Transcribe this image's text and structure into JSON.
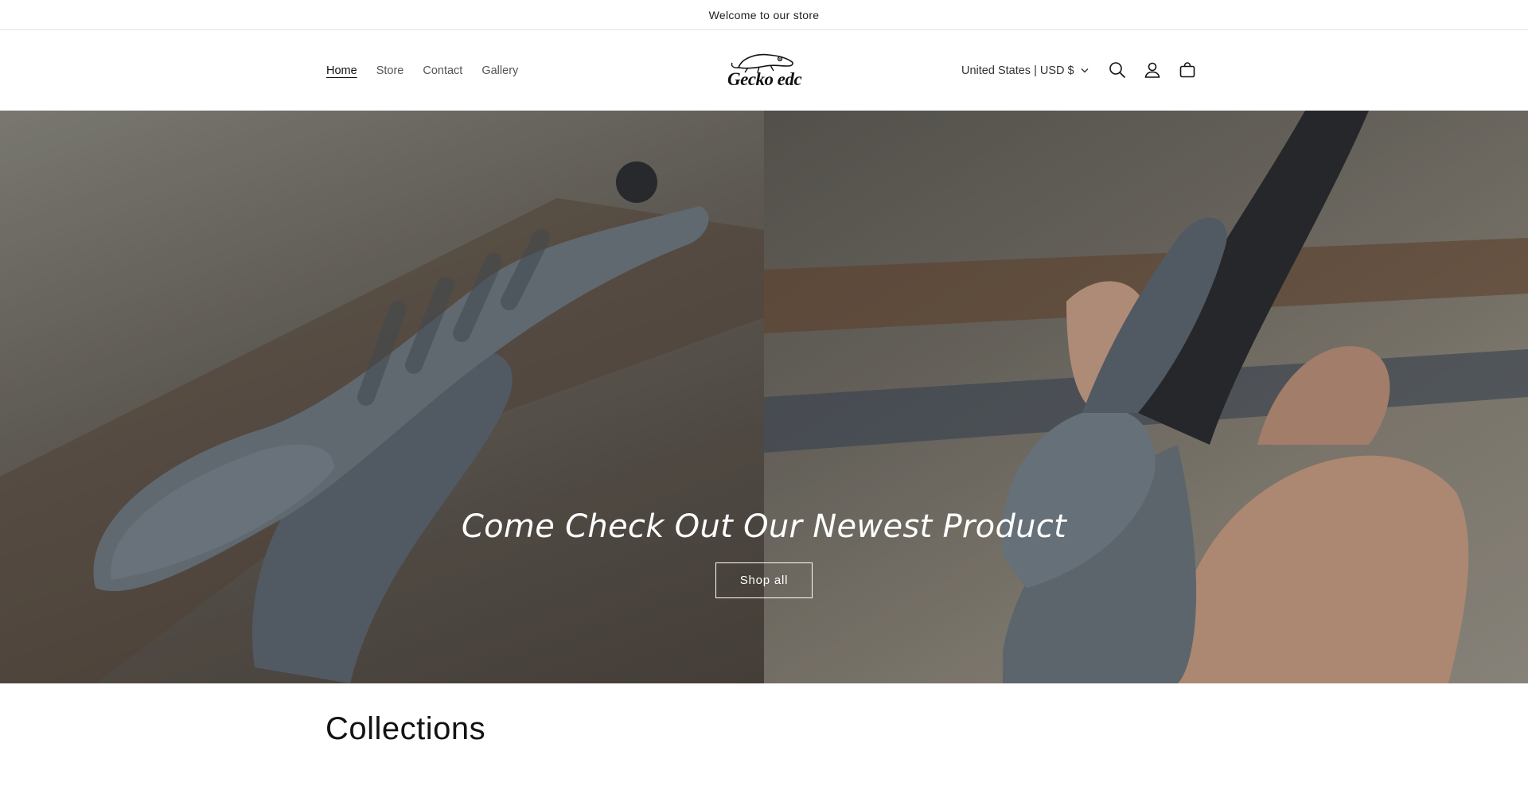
{
  "announcement": {
    "text": "Welcome to our store"
  },
  "header": {
    "nav": [
      {
        "label": "Home",
        "active": true
      },
      {
        "label": "Store",
        "active": false
      },
      {
        "label": "Contact",
        "active": false
      },
      {
        "label": "Gallery",
        "active": false
      }
    ],
    "logo_text": "Gecko edc",
    "localization": "United States | USD $",
    "icons": [
      "search-icon",
      "account-icon",
      "cart-icon"
    ]
  },
  "hero": {
    "title": "Come Check Out Our Newest Product",
    "button_label": "Shop all"
  },
  "collections": {
    "title": "Collections"
  },
  "colors": {
    "text": "#121212",
    "hero_text": "#ffffff",
    "border": "#e6e6e6"
  }
}
